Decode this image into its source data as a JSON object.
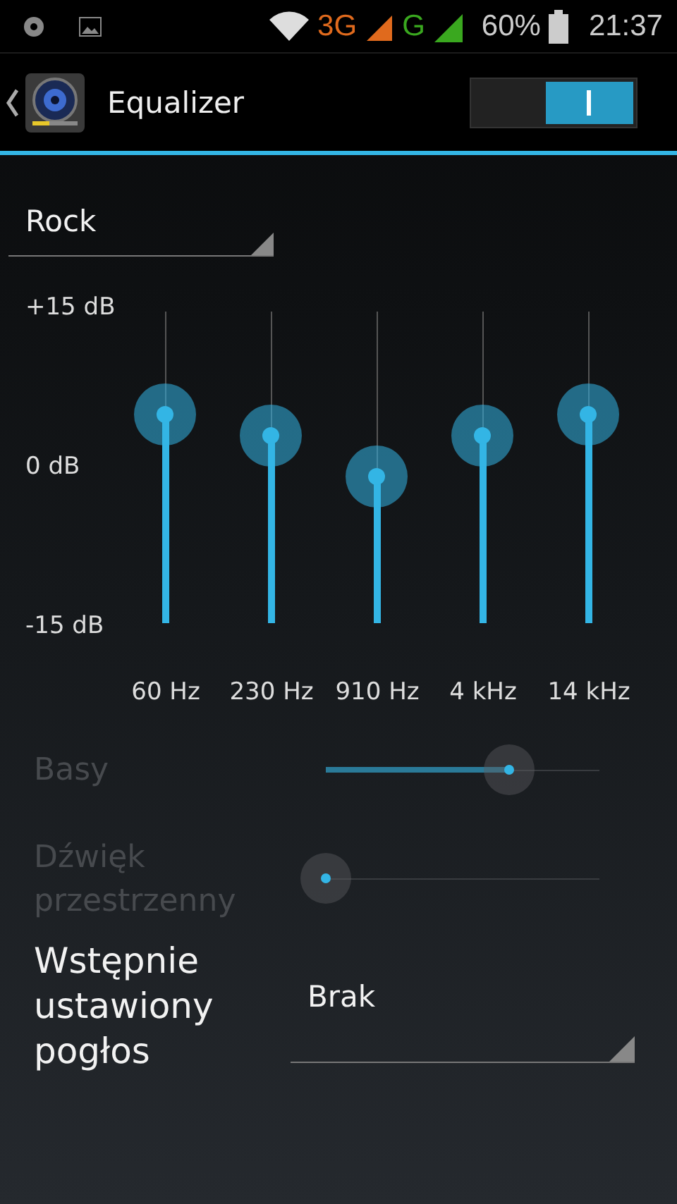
{
  "status_bar": {
    "network_3g": "3G",
    "network_g": "G",
    "battery": "60%",
    "time": "21:37"
  },
  "action_bar": {
    "title": "Equalizer",
    "enabled": true
  },
  "preset": {
    "value": "Rock"
  },
  "equalizer": {
    "scale": [
      "+15 dB",
      "0 dB",
      "-15 dB"
    ],
    "bands": [
      {
        "label": "60 Hz",
        "level": 0.67
      },
      {
        "label": "230 Hz",
        "level": 0.6
      },
      {
        "label": "910 Hz",
        "level": 0.47
      },
      {
        "label": "4 kHz",
        "level": 0.6
      },
      {
        "label": "14 kHz",
        "level": 0.67
      }
    ]
  },
  "effects": [
    {
      "label": "Basy",
      "disabled": true,
      "level": 0.67
    },
    {
      "label": "Dźwięk przestrzenny",
      "disabled": true,
      "level": 0
    }
  ],
  "reverb": {
    "label": "Wstępnie ustawiony pogłos",
    "value": "Brak"
  }
}
